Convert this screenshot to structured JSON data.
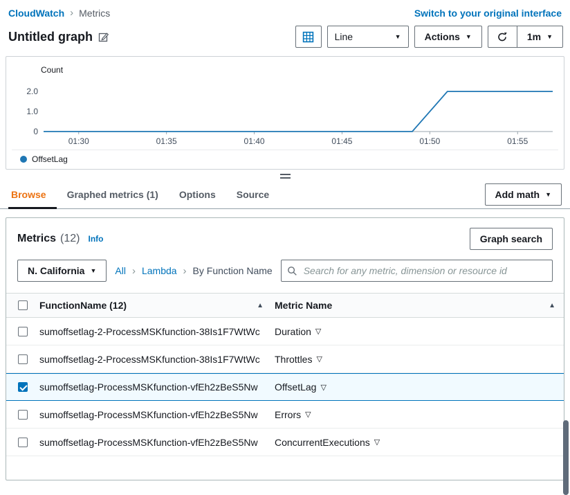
{
  "ui": {
    "separator": "›"
  },
  "icons": {
    "caret": "▼",
    "sort_asc": "▲",
    "filter": "▽"
  },
  "breadcrumb": {
    "app": "CloudWatch",
    "page": "Metrics"
  },
  "switch_link": "Switch to your original interface",
  "graph_header": {
    "title": "Untitled graph"
  },
  "toolbar": {
    "chart_type": "Line",
    "actions_label": "Actions",
    "refresh_interval": "1m"
  },
  "chart_data": {
    "type": "line",
    "title": "Untitled graph",
    "ylabel": "Count",
    "xlabel": "",
    "grid": false,
    "legend_position": "bottom",
    "x_range": [
      "01:28",
      "01:57"
    ],
    "ylim": [
      0,
      2.35
    ],
    "x_ticks": [
      "01:30",
      "01:35",
      "01:40",
      "01:45",
      "01:50",
      "01:55"
    ],
    "y_ticks": [
      {
        "label": "0",
        "value": 0
      },
      {
        "label": "1.0",
        "value": 1
      },
      {
        "label": "2.0",
        "value": 2
      }
    ],
    "series": [
      {
        "name": "OffsetLag",
        "color": "#1f77b4",
        "points": [
          [
            "01:28",
            0
          ],
          [
            "01:49",
            0
          ],
          [
            "01:51",
            2
          ],
          [
            "01:57",
            2
          ]
        ]
      }
    ]
  },
  "tabs": [
    {
      "label": "Browse",
      "active": true
    },
    {
      "label": "Graphed metrics (1)",
      "active": false
    },
    {
      "label": "Options",
      "active": false
    },
    {
      "label": "Source",
      "active": false
    }
  ],
  "add_math_label": "Add math",
  "metrics_panel": {
    "title": "Metrics",
    "count": "(12)",
    "info_link": "Info",
    "graph_search_label": "Graph search",
    "region": "N. California",
    "filter_breadcrumb": {
      "all": "All",
      "namespace": "Lambda",
      "dimension": "By Function Name"
    },
    "search_placeholder": "Search for any metric, dimension or resource id"
  },
  "table": {
    "header": {
      "col_function": "FunctionName  (12)",
      "col_metric": "Metric Name"
    },
    "rows": [
      {
        "checked": false,
        "selected": false,
        "function_name": "sumoffsetlag-2-ProcessMSKfunction-38Is1F7WtWc",
        "metric_name": "Duration"
      },
      {
        "checked": false,
        "selected": false,
        "function_name": "sumoffsetlag-2-ProcessMSKfunction-38Is1F7WtWc",
        "metric_name": "Throttles"
      },
      {
        "checked": true,
        "selected": true,
        "function_name": "sumoffsetlag-ProcessMSKfunction-vfEh2zBeS5Nw",
        "metric_name": "OffsetLag"
      },
      {
        "checked": false,
        "selected": false,
        "function_name": "sumoffsetlag-ProcessMSKfunction-vfEh2zBeS5Nw",
        "metric_name": "Errors"
      },
      {
        "checked": false,
        "selected": false,
        "function_name": "sumoffsetlag-ProcessMSKfunction-vfEh2zBeS5Nw",
        "metric_name": "ConcurrentExecutions"
      }
    ]
  }
}
